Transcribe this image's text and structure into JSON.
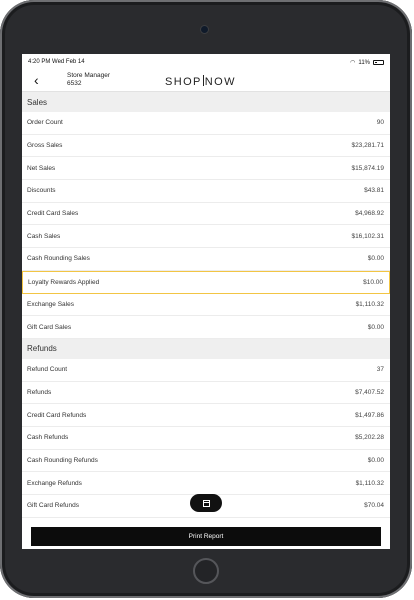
{
  "status": {
    "time": "4:20 PM",
    "date": "Wed Feb 14",
    "battery": "11%"
  },
  "header": {
    "user_role": "Store Manager",
    "user_id": "6532",
    "logo_left": "SHOP",
    "logo_right": "NOW"
  },
  "sales": {
    "title": "Sales",
    "rows": [
      {
        "label": "Order Count",
        "value": "90"
      },
      {
        "label": "Gross Sales",
        "value": "$23,281.71"
      },
      {
        "label": "Net Sales",
        "value": "$15,874.19"
      },
      {
        "label": "Discounts",
        "value": "$43.81"
      },
      {
        "label": "Credit Card Sales",
        "value": "$4,968.92"
      },
      {
        "label": "Cash Sales",
        "value": "$16,102.31"
      },
      {
        "label": "Cash Rounding Sales",
        "value": "$0.00"
      },
      {
        "label": "Loyalty Rewards Applied",
        "value": "$10.00"
      },
      {
        "label": "Exchange Sales",
        "value": "$1,110.32"
      },
      {
        "label": "Gift Card Sales",
        "value": "$0.00"
      }
    ]
  },
  "refunds": {
    "title": "Refunds",
    "rows": [
      {
        "label": "Refund Count",
        "value": "37"
      },
      {
        "label": "Refunds",
        "value": "$7,407.52"
      },
      {
        "label": "Credit Card Refunds",
        "value": "$1,497.86"
      },
      {
        "label": "Cash Refunds",
        "value": "$5,202.28"
      },
      {
        "label": "Cash Rounding Refunds",
        "value": "$0.00"
      },
      {
        "label": "Exchange Refunds",
        "value": "$1,110.32"
      },
      {
        "label": "Gift Card Refunds",
        "value": "$70.04"
      }
    ]
  },
  "actions": {
    "print_label": "Print Report"
  },
  "colors": {
    "highlight": "#f2c544",
    "button": "#0c0c0c"
  }
}
